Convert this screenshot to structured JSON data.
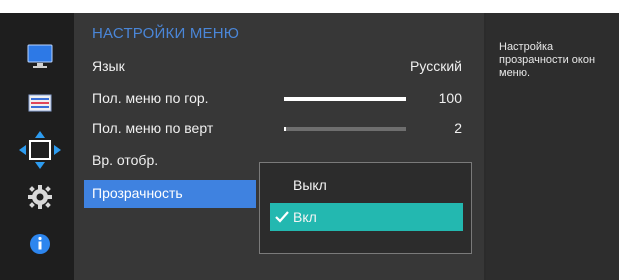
{
  "menu": {
    "title": "НАСТРОЙКИ МЕНЮ",
    "items": [
      {
        "label": "Язык",
        "value": "Русский"
      },
      {
        "label": "Пол. меню по гор.",
        "value": "100",
        "level": 1.0
      },
      {
        "label": "Пол. меню по верт",
        "value": "2",
        "level": 0.02
      },
      {
        "label": "Вр. отобр.",
        "value": ""
      },
      {
        "label": "Прозрачность",
        "value": ""
      }
    ]
  },
  "popup": {
    "options": [
      {
        "label": "Выкл",
        "selected": false
      },
      {
        "label": "Вкл",
        "selected": true
      }
    ]
  },
  "help": {
    "text": "Настройка прозрачности окон меню."
  },
  "sidebar": {
    "icons": [
      "monitor-icon",
      "picture-settings-icon",
      "position-arrows-icon",
      "gear-icon",
      "info-icon"
    ]
  },
  "colors": {
    "accent_blue": "#3f82e0",
    "title_blue": "#4a86d8",
    "teal": "#23b8b0"
  }
}
